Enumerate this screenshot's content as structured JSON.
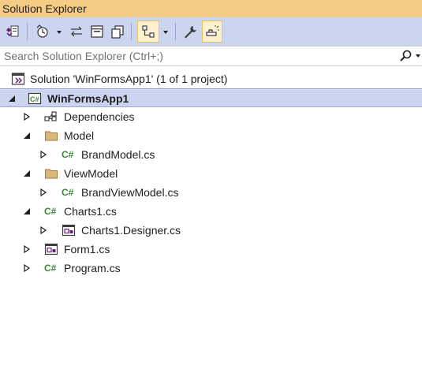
{
  "window": {
    "title": "Solution Explorer"
  },
  "toolbar": {
    "items": [
      {
        "name": "switch-views-icon"
      },
      {
        "name": "pending-changes-filter-icon"
      },
      {
        "name": "sync-with-active-document-icon"
      },
      {
        "name": "collapse-all-icon"
      },
      {
        "name": "show-all-files-icon"
      },
      {
        "name": "show-class-view-icon",
        "checked": true
      },
      {
        "name": "properties-icon"
      },
      {
        "name": "preview-selected-items-icon",
        "checked": true
      }
    ]
  },
  "search": {
    "placeholder": "Search Solution Explorer (Ctrl+;)",
    "value": ""
  },
  "tree": {
    "solution": "Solution 'WinFormsApp1' (1 of 1 project)",
    "project": "WinFormsApp1",
    "dependencies": "Dependencies",
    "model_folder": "Model",
    "brand_model": "BrandModel.cs",
    "viewmodel_folder": "ViewModel",
    "brand_viewmodel": "BrandViewModel.cs",
    "charts1": "Charts1.cs",
    "charts1_designer": "Charts1.Designer.cs",
    "form1": "Form1.cs",
    "program": "Program.cs",
    "cs_badge": "C#"
  },
  "colors": {
    "title_bar": "#f5cc84",
    "toolbar": "#ccd5f0",
    "selection": "#ccd5f0",
    "csharp_green": "#388a34",
    "folder": "#dcb67a"
  }
}
